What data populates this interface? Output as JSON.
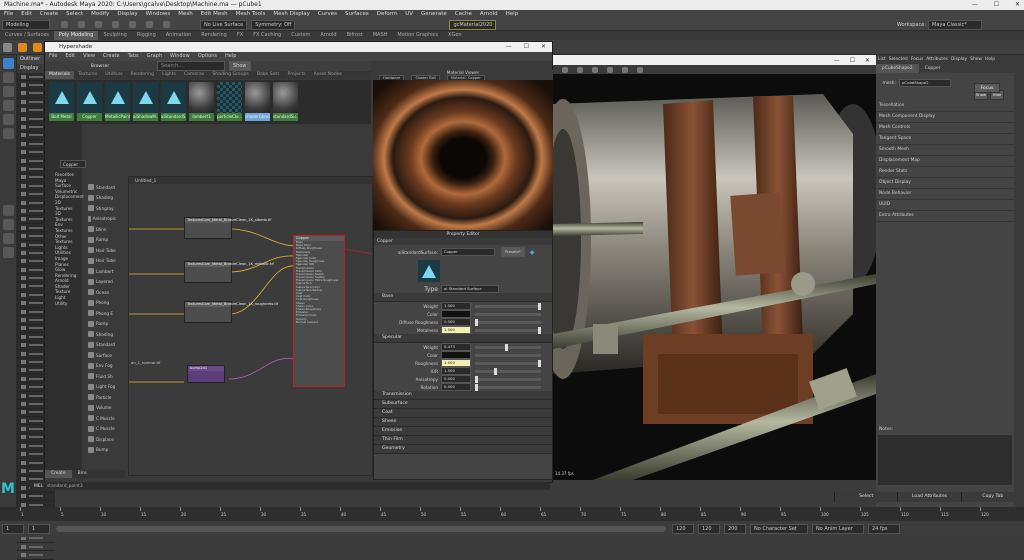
{
  "window": {
    "title": "Machine.ma* - Autodesk Maya 2020: C:\\Users\\gcalve\\Desktop\\Machine.ma — pCube1"
  },
  "menubar": [
    "File",
    "Edit",
    "Create",
    "Select",
    "Modify",
    "Display",
    "Windows",
    "Mesh",
    "Edit Mesh",
    "Mesh Tools",
    "Mesh Display",
    "Curves",
    "Surfaces",
    "Deform",
    "UV",
    "Generate",
    "Cache",
    "Arnold",
    "Help"
  ],
  "statusline": {
    "mode": "Modeling",
    "no_live": "No Live Surface",
    "symmetry": "Symmetry: Off",
    "renderer": "gcMaterial2020",
    "workspace_label": "Workspace:",
    "workspace": "Maya Classic*"
  },
  "shelftabs": [
    "Curves / Surfaces",
    "Poly Modeling",
    "Sculpting",
    "Rigging",
    "Animation",
    "Rendering",
    "FX",
    "FX Caching",
    "Custom",
    "Arnold",
    "Bifrost",
    "MASH",
    "Motion Graphics",
    "XGen"
  ],
  "shelftab_active": 1,
  "outliner": {
    "title": "Outliner",
    "menu": "Display"
  },
  "hypershade": {
    "title": "Hypershade",
    "menu": [
      "File",
      "Edit",
      "View",
      "Create",
      "Tabs",
      "Graph",
      "Window",
      "Options",
      "Help"
    ],
    "browser_label": "Browser",
    "search_placeholder": "Search...",
    "show_button": "Show",
    "tabs": [
      "Materials",
      "Textures",
      "Utilities",
      "Rendering",
      "Lights",
      "Cameras",
      "Shading Groups",
      "Bake Sets",
      "Projects",
      "Asset Nodes"
    ],
    "materials": [
      {
        "label": "Bolt Metal",
        "kind": "arnold"
      },
      {
        "label": "Copper",
        "kind": "arnold"
      },
      {
        "label": "MetallicPaint",
        "kind": "arnold"
      },
      {
        "label": "aiShadowM...",
        "kind": "arnold"
      },
      {
        "label": "aiStandardS...",
        "kind": "arnold"
      },
      {
        "label": "lambert1",
        "kind": "ball"
      },
      {
        "label": "particleClo...",
        "kind": "chk"
      },
      {
        "label": "shaderGlow1",
        "kind": "ball"
      },
      {
        "label": "standardSu...",
        "kind": "ball"
      }
    ],
    "create_panel_title": "Create",
    "create_search": "Copper",
    "bin_tree": [
      "Favorites",
      "Maya",
      "Surface",
      "Volumetric",
      "Displacement",
      "2D Textures",
      "3D Textures",
      "Env Textures",
      "Other Textures",
      "Lights",
      "Utilities",
      "Image Planes",
      "Glow",
      "Rendering",
      "Arnold",
      "Shader",
      "Texture",
      "Light",
      "Utility"
    ],
    "node_list": [
      "Standard",
      "Shading",
      "Stingray",
      "Anisotropic",
      "Blinn",
      "Ramp",
      "Hair Tube",
      "Hair Tube",
      "Lambert",
      "Layered",
      "Ocean",
      "Phong",
      "Phong E",
      "Ramp",
      "Shading",
      "Standard",
      "Surface",
      "Env Fog",
      "Fluid Sh",
      "Light Fog",
      "Particle",
      "Volume",
      "C Muscle",
      "C Muscle",
      "Displace",
      "Bump"
    ],
    "graph_tab": "Untitled_1",
    "bottom_tabs": [
      "Create",
      "Bins"
    ],
    "nodes": {
      "tex1": "TexturesCom_Metal_BronzeClean_1K_albedo.tif",
      "tex2": "TexturesCom_Metal_BronzeClean_1K_metallic.tif",
      "tex3": "TexturesCom_Metal_BronzeClean_1K_roughness.tif",
      "ramp": "an_1_normal.tif",
      "bump": "bump2d1",
      "copper": "Copper"
    },
    "copper_attrs": [
      "Base",
      "Base Color",
      "Diffuse Roughness",
      "Metalness",
      "Specular",
      "Specular Color",
      "Specular Roughness",
      "Specular IOR",
      "Transmission",
      "Transmission Color",
      "Transmission Depth",
      "Transmission Scatter",
      "Transmission Extra Roughness",
      "Subsurface",
      "Subsurface Color",
      "Subsurface Radius",
      "Coat",
      "Coat Color",
      "Coat Roughness",
      "Sheen",
      "Sheen Color",
      "Sheen Roughness",
      "Emission",
      "Emission Color",
      "Opacity",
      "Normal Camera"
    ]
  },
  "material_viewer": {
    "title": "Material Viewer",
    "renderer": "Hardware",
    "shape": "Shader Ball",
    "target": "Material: Copper"
  },
  "property_editor": {
    "title": "Property Editor",
    "material_name": "Copper",
    "type_label": "aiStandardSurface:",
    "type_value": "Copper",
    "presets": "Presets*",
    "type_row_label": "Type",
    "type_row_value": "ai Standard Surface",
    "sections": [
      {
        "name": "Base",
        "rows": [
          {
            "label": "Weight",
            "value": "1.000",
            "fill": 1.0
          },
          {
            "label": "Color",
            "value": "",
            "fill": null,
            "swatch": "#111111"
          },
          {
            "label": "Diffuse Roughness",
            "value": "0.000",
            "fill": 0.0
          },
          {
            "label": "Metalness",
            "value": "1.000",
            "fill": 1.0,
            "hl": true
          }
        ]
      },
      {
        "name": "Specular",
        "rows": [
          {
            "label": "Weight",
            "value": "0.473",
            "fill": 0.47
          },
          {
            "label": "Color",
            "value": "",
            "fill": null,
            "swatch": "#111111"
          },
          {
            "label": "Roughness",
            "value": "1.000",
            "fill": 1.0,
            "hl": true
          },
          {
            "label": "IOR",
            "value": "1.500",
            "fill": 0.3
          },
          {
            "label": "Anisotropy",
            "value": "0.000",
            "fill": 0.0
          },
          {
            "label": "Rotation",
            "value": "0.000",
            "fill": 0.0
          }
        ]
      }
    ],
    "collapsed": [
      "Transmission",
      "Subsurface",
      "Coat",
      "Sheen",
      "Emission",
      "Thin Film",
      "Geometry"
    ]
  },
  "viewport": {
    "camera_label": "persp",
    "fps": "14.37 fps"
  },
  "attribute_editor": {
    "menu": [
      "List",
      "Selected",
      "Focus",
      "Attributes",
      "Display",
      "Show",
      "Help"
    ],
    "tab_shape": "pCubeShape2",
    "tab_material": "Copper",
    "object_label": "mesh:",
    "object_value": "pCubeShape2",
    "focus_button": "Focus",
    "presets_button": "Presets",
    "show_button": "Show",
    "hide_button": "Hide",
    "sections": [
      "Tessellation",
      "Mesh Component Display",
      "Mesh Controls",
      "Tangent Space",
      "Smooth Mesh",
      "Displacement Map",
      "Render Stats",
      "Object Display",
      "Node Behavior",
      "UUID",
      "Extra Attributes"
    ],
    "notes_label": "Notes:"
  },
  "bottom_buttons": [
    "Select",
    "Load Attributes",
    "Copy Tab"
  ],
  "command_line": {
    "mel": "MEL",
    "history": "standard_point3"
  },
  "timeline": {
    "ticks": [
      "1",
      "5",
      "10",
      "15",
      "20",
      "25",
      "30",
      "35",
      "40",
      "45",
      "50",
      "55",
      "60",
      "65",
      "70",
      "75",
      "80",
      "85",
      "90",
      "95",
      "100",
      "105",
      "110",
      "115",
      "120"
    ],
    "current": "1"
  },
  "range": {
    "start": "1",
    "inner_start": "1",
    "inner_end": "120",
    "end": "120",
    "end2": "200",
    "char_set": "No Character Set",
    "anim_layer": "No Anim Layer",
    "fps": "24 fps"
  }
}
